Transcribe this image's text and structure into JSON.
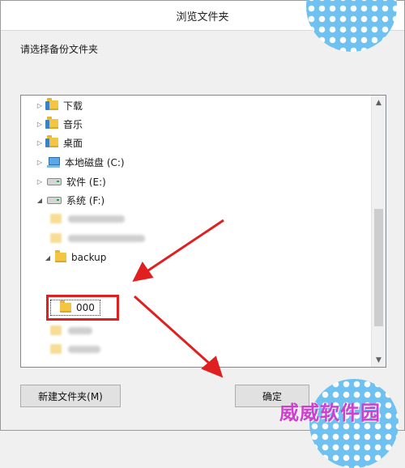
{
  "window": {
    "title": "浏览文件夹"
  },
  "instruction": "请选择备份文件夹",
  "tree": [
    {
      "label": "下载",
      "type": "lib-folder",
      "expander": "▷"
    },
    {
      "label": "音乐",
      "type": "lib-folder",
      "expander": "▷"
    },
    {
      "label": "桌面",
      "type": "lib-folder",
      "expander": "▷"
    },
    {
      "label": "本地磁盘 (C:)",
      "type": "pc",
      "expander": "▷"
    },
    {
      "label": "软件 (E:)",
      "type": "drive",
      "expander": "▷"
    },
    {
      "label": "系统 (F:)",
      "type": "drive",
      "expander": "◢"
    },
    {
      "label": "backup",
      "type": "folder",
      "expander": "◢"
    },
    {
      "label": "000",
      "type": "folder",
      "expander": ""
    }
  ],
  "scrollbar": {
    "up": "▲",
    "down": "▼"
  },
  "buttons": {
    "new_folder": "新建文件夹(M)",
    "ok": "确定"
  },
  "watermark": "威威软件园",
  "colors": {
    "highlight": "#e02020",
    "watermark": "#d03fd0",
    "dots": "#6ec1f0"
  }
}
